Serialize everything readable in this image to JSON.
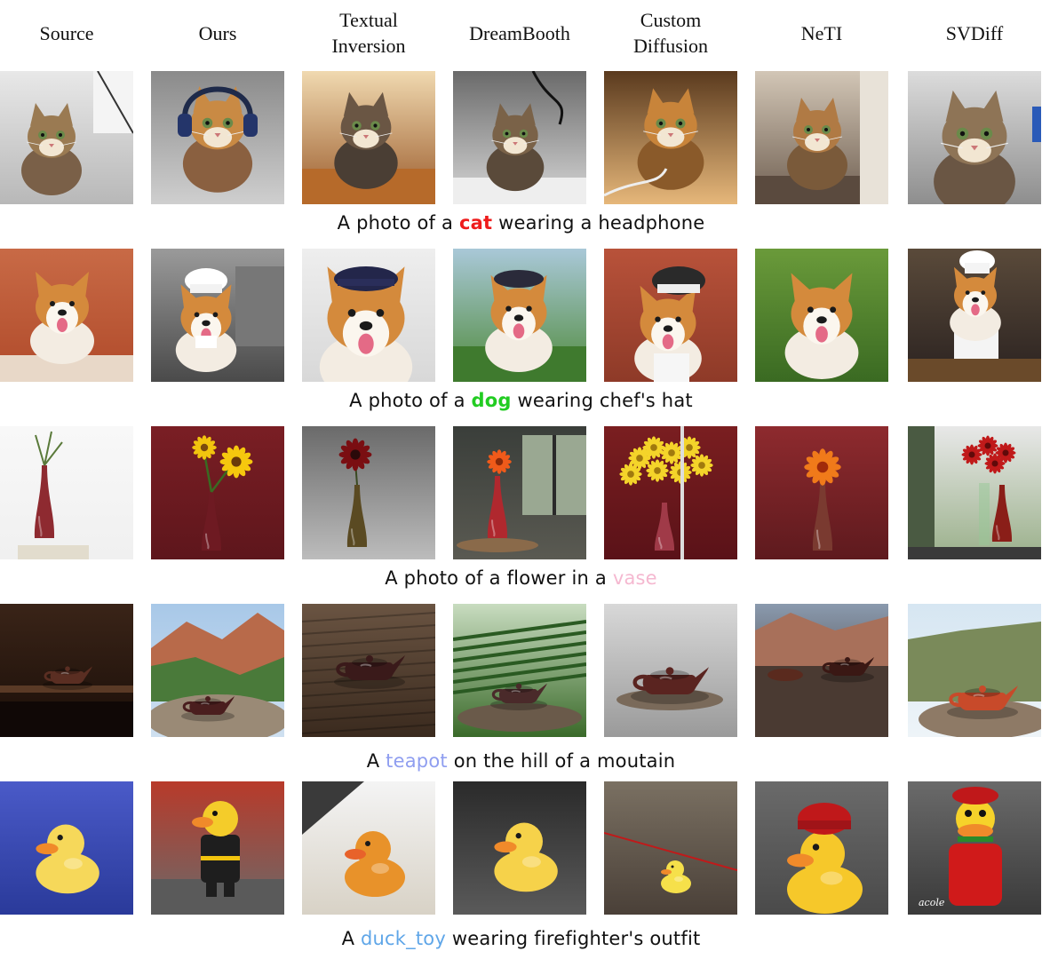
{
  "columns": [
    {
      "lines": [
        "Source"
      ]
    },
    {
      "lines": [
        "Ours"
      ]
    },
    {
      "lines": [
        "Textual",
        "Inversion"
      ]
    },
    {
      "lines": [
        "DreamBooth"
      ]
    },
    {
      "lines": [
        "Custom",
        "Diffusion"
      ]
    },
    {
      "lines": [
        "NeTI"
      ]
    },
    {
      "lines": [
        "SVDiff"
      ]
    }
  ],
  "rows": [
    {
      "subject": "cat",
      "caption": {
        "before": "A photo of a ",
        "keyword": "cat",
        "after": " wearing a headphone",
        "keyword_color": "#ee1c1c",
        "keyword_bold": true
      },
      "tiles": [
        {
          "scene": "kitten-studio"
        },
        {
          "scene": "kitten-headphones"
        },
        {
          "scene": "kitten-warm"
        },
        {
          "scene": "kitten-cable"
        },
        {
          "scene": "kitten-cable-warm"
        },
        {
          "scene": "kitten-indoor"
        },
        {
          "scene": "kitten-closeup"
        }
      ]
    },
    {
      "subject": "dog",
      "caption": {
        "before": "A photo of a ",
        "keyword": "dog",
        "after": " wearing chef's hat",
        "keyword_color": "#22cc22",
        "keyword_bold": true
      },
      "tiles": [
        {
          "scene": "corgi-red-wall"
        },
        {
          "scene": "corgi-chef-kitchen"
        },
        {
          "scene": "corgi-cap"
        },
        {
          "scene": "corgi-cap-outdoor"
        },
        {
          "scene": "corgi-chef-hat"
        },
        {
          "scene": "corgi-grass"
        },
        {
          "scene": "dog-chef-outfit"
        }
      ]
    },
    {
      "subject": "vase",
      "caption": {
        "before": "A photo of a flower in a ",
        "keyword": "vase",
        "after": "",
        "keyword_color": "#f5b8d0",
        "keyword_bold": false
      },
      "tiles": [
        {
          "scene": "vase-white"
        },
        {
          "scene": "vase-sunflower"
        },
        {
          "scene": "vase-dark-flower"
        },
        {
          "scene": "vase-window"
        },
        {
          "scene": "vase-yellow-bouquet"
        },
        {
          "scene": "vase-orange-flower"
        },
        {
          "scene": "vase-red-roses"
        }
      ]
    },
    {
      "subject": "teapot",
      "caption": {
        "before": "A ",
        "keyword": "teapot",
        "after": " on the hill of a moutain",
        "keyword_color": "#8f9ef0",
        "keyword_bold": false
      },
      "tiles": [
        {
          "scene": "teapot-dark-shelf"
        },
        {
          "scene": "teapot-mountain"
        },
        {
          "scene": "teapot-wood"
        },
        {
          "scene": "teapot-field"
        },
        {
          "scene": "teapot-plate"
        },
        {
          "scene": "teapot-cups"
        },
        {
          "scene": "teapot-hill-rock"
        }
      ]
    },
    {
      "subject": "duck_toy",
      "caption": {
        "before": "A ",
        "keyword": "duck_toy",
        "after": " wearing firefighter's outfit",
        "keyword_color": "#5fa6e8",
        "keyword_bold": false
      },
      "tiles": [
        {
          "scene": "duck-blue-carpet"
        },
        {
          "scene": "duck-firefighter"
        },
        {
          "scene": "duck-orange"
        },
        {
          "scene": "duck-gravel"
        },
        {
          "scene": "duck-small-floor"
        },
        {
          "scene": "duck-red-hat"
        },
        {
          "scene": "duck-red-figure",
          "watermark": "acole"
        }
      ]
    }
  ]
}
